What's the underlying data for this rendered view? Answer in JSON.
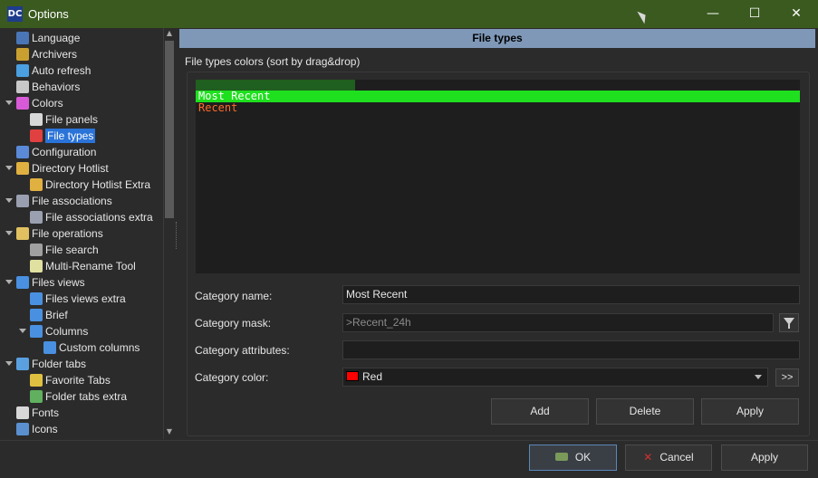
{
  "window": {
    "title": "Options",
    "app_icon": "DC"
  },
  "controls": {
    "minimize": "—",
    "maximize": "☐",
    "close": "✕"
  },
  "tree": {
    "items": [
      {
        "label": "Language",
        "icon": "language-icon",
        "color": "#4a76b8"
      },
      {
        "label": "Archivers",
        "icon": "archivers-icon",
        "color": "#c9a030"
      },
      {
        "label": "Auto refresh",
        "icon": "refresh-icon",
        "color": "#4aa0e0"
      },
      {
        "label": "Behaviors",
        "icon": "behaviors-icon",
        "color": "#c8c8c8"
      },
      {
        "label": "Colors",
        "icon": "colors-icon",
        "color": "#d85ad8"
      },
      {
        "label": "File panels",
        "icon": "file-panels-icon",
        "color": "#d8d8d8"
      },
      {
        "label": "File types",
        "icon": "file-types-icon",
        "color": "#e04040"
      },
      {
        "label": "Configuration",
        "icon": "configuration-icon",
        "color": "#5a8ad8"
      },
      {
        "label": "Directory Hotlist",
        "icon": "hotlist-icon",
        "color": "#e0b040"
      },
      {
        "label": "Directory Hotlist Extra",
        "icon": "hotlist-extra-icon",
        "color": "#e0b040"
      },
      {
        "label": "File associations",
        "icon": "file-associations-icon",
        "color": "#9aa0b0"
      },
      {
        "label": "File associations extra",
        "icon": "file-associations-extra-icon",
        "color": "#9aa0b0"
      },
      {
        "label": "File operations",
        "icon": "file-operations-icon",
        "color": "#e0c060"
      },
      {
        "label": "File search",
        "icon": "binoculars-icon",
        "color": "#a0a0a0"
      },
      {
        "label": "Multi-Rename Tool",
        "icon": "rename-icon",
        "color": "#e0e0a0"
      },
      {
        "label": "Files views",
        "icon": "files-views-icon",
        "color": "#4a90e0"
      },
      {
        "label": "Files views extra",
        "icon": "files-views-extra-icon",
        "color": "#4a90e0"
      },
      {
        "label": "Brief",
        "icon": "brief-icon",
        "color": "#4a90e0"
      },
      {
        "label": "Columns",
        "icon": "columns-icon",
        "color": "#4a90e0"
      },
      {
        "label": "Custom columns",
        "icon": "custom-columns-icon",
        "color": "#4a90e0"
      },
      {
        "label": "Folder tabs",
        "icon": "folder-tabs-icon",
        "color": "#5aa0e0"
      },
      {
        "label": "Favorite Tabs",
        "icon": "favorite-tabs-icon",
        "color": "#e0c040"
      },
      {
        "label": "Folder tabs extra",
        "icon": "folder-tabs-extra-icon",
        "color": "#60b060"
      },
      {
        "label": "Fonts",
        "icon": "fonts-icon",
        "color": "#d8d8d8"
      },
      {
        "label": "Icons",
        "icon": "icons-icon",
        "color": "#5a90d0"
      }
    ],
    "selected": "File types",
    "expanders": [
      "Colors",
      "Directory Hotlist",
      "File associations",
      "File operations",
      "Files views",
      "Columns",
      "Folder tabs"
    ]
  },
  "panel": {
    "header": "File types",
    "section_label": "File types colors (sort by drag&drop)",
    "file_types": [
      {
        "label": "Most Recent",
        "fg": "#ffffff",
        "bg": "#1ee01e"
      },
      {
        "label": "Recent",
        "fg": "#ff6a2a",
        "bg": "transparent"
      }
    ],
    "form": {
      "name_label": "Category name:",
      "name_value": "Most Recent",
      "mask_label": "Category mask:",
      "mask_value": ">Recent_24h",
      "attributes_label": "Category attributes:",
      "attributes_value": "",
      "color_label": "Category color:",
      "color_value": "Red",
      "color_swatch": "#ff0000",
      "more_button": ">>"
    },
    "buttons": {
      "add": "Add",
      "delete": "Delete",
      "apply": "Apply"
    }
  },
  "footer": {
    "ok": "OK",
    "cancel": "Cancel",
    "apply": "Apply"
  }
}
